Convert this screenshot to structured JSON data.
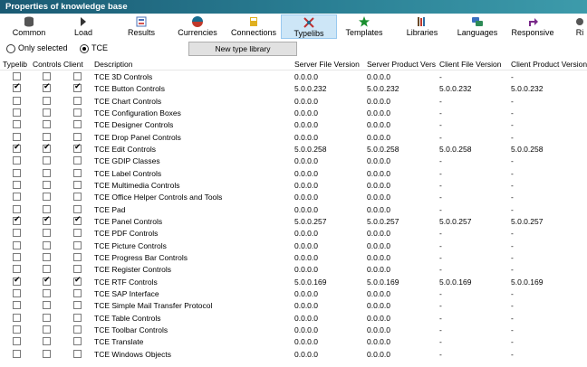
{
  "window": {
    "title": "Properties of knowledge base"
  },
  "toolbar": {
    "items": [
      {
        "label": "Common",
        "icon": "database-icon",
        "color": "#555555"
      },
      {
        "label": "Load",
        "icon": "load-icon",
        "color": "#333333"
      },
      {
        "label": "Results",
        "icon": "results-icon",
        "color": "#4a6fb5"
      },
      {
        "label": "Currencies",
        "icon": "currencies-icon",
        "color": "#1a6d8f"
      },
      {
        "label": "Connections",
        "icon": "connections-icon",
        "color": "#e0b020"
      },
      {
        "label": "Typelibs",
        "icon": "typelibs-icon",
        "color": "#c03030"
      },
      {
        "label": "Templates",
        "icon": "templates-icon",
        "color": "#1a8f2f"
      },
      {
        "label": "Libraries",
        "icon": "libraries-icon",
        "color": "#6b4a2a"
      },
      {
        "label": "Languages",
        "icon": "languages-icon",
        "color": "#3a6fc0"
      },
      {
        "label": "Responsive",
        "icon": "responsive-icon",
        "color": "#7a2a8a"
      },
      {
        "label": "Ri",
        "icon": "more-icon",
        "color": "#555555"
      }
    ],
    "active": "Typelibs"
  },
  "options": {
    "only_selected_label": "Only selected",
    "tce_label": "TCE",
    "selected": "TCE",
    "new_type_library_label": "New type library"
  },
  "table": {
    "columns": [
      "Typelib",
      "Controls",
      "Client",
      "Description",
      "Server File Version",
      "Server Product Versi...",
      "Client File Version",
      "Client Product Version"
    ],
    "rows": [
      {
        "typelib": false,
        "controls": false,
        "client": false,
        "description": "TCE 3D Controls",
        "server_file": "0.0.0.0",
        "server_product": "0.0.0.0",
        "client_file": "-",
        "client_product": "-"
      },
      {
        "typelib": true,
        "controls": true,
        "client": true,
        "description": "TCE Button Controls",
        "server_file": "5.0.0.232",
        "server_product": "5.0.0.232",
        "client_file": "5.0.0.232",
        "client_product": "5.0.0.232"
      },
      {
        "typelib": false,
        "controls": false,
        "client": false,
        "description": "TCE Chart Controls",
        "server_file": "0.0.0.0",
        "server_product": "0.0.0.0",
        "client_file": "-",
        "client_product": "-"
      },
      {
        "typelib": false,
        "controls": false,
        "client": false,
        "description": "TCE Configuration Boxes",
        "server_file": "0.0.0.0",
        "server_product": "0.0.0.0",
        "client_file": "-",
        "client_product": "-"
      },
      {
        "typelib": false,
        "controls": false,
        "client": false,
        "description": "TCE Designer Controls",
        "server_file": "0.0.0.0",
        "server_product": "0.0.0.0",
        "client_file": "-",
        "client_product": "-"
      },
      {
        "typelib": false,
        "controls": false,
        "client": false,
        "description": "TCE Drop Panel Controls",
        "server_file": "0.0.0.0",
        "server_product": "0.0.0.0",
        "client_file": "-",
        "client_product": "-"
      },
      {
        "typelib": true,
        "controls": true,
        "client": true,
        "description": "TCE Edit Controls",
        "server_file": "5.0.0.258",
        "server_product": "5.0.0.258",
        "client_file": "5.0.0.258",
        "client_product": "5.0.0.258"
      },
      {
        "typelib": false,
        "controls": false,
        "client": false,
        "description": "TCE GDIP Classes",
        "server_file": "0.0.0.0",
        "server_product": "0.0.0.0",
        "client_file": "-",
        "client_product": "-"
      },
      {
        "typelib": false,
        "controls": false,
        "client": false,
        "description": "TCE Label Controls",
        "server_file": "0.0.0.0",
        "server_product": "0.0.0.0",
        "client_file": "-",
        "client_product": "-"
      },
      {
        "typelib": false,
        "controls": false,
        "client": false,
        "description": "TCE Multimedia Controls",
        "server_file": "0.0.0.0",
        "server_product": "0.0.0.0",
        "client_file": "-",
        "client_product": "-"
      },
      {
        "typelib": false,
        "controls": false,
        "client": false,
        "description": "TCE Office Helper Controls and Tools",
        "server_file": "0.0.0.0",
        "server_product": "0.0.0.0",
        "client_file": "-",
        "client_product": "-"
      },
      {
        "typelib": false,
        "controls": false,
        "client": false,
        "description": "TCE Pad",
        "server_file": "0.0.0.0",
        "server_product": "0.0.0.0",
        "client_file": "-",
        "client_product": "-"
      },
      {
        "typelib": true,
        "controls": true,
        "client": true,
        "description": "TCE Panel Controls",
        "server_file": "5.0.0.257",
        "server_product": "5.0.0.257",
        "client_file": "5.0.0.257",
        "client_product": "5.0.0.257"
      },
      {
        "typelib": false,
        "controls": false,
        "client": false,
        "description": "TCE PDF Controls",
        "server_file": "0.0.0.0",
        "server_product": "0.0.0.0",
        "client_file": "-",
        "client_product": "-"
      },
      {
        "typelib": false,
        "controls": false,
        "client": false,
        "description": "TCE Picture Controls",
        "server_file": "0.0.0.0",
        "server_product": "0.0.0.0",
        "client_file": "-",
        "client_product": "-"
      },
      {
        "typelib": false,
        "controls": false,
        "client": false,
        "description": "TCE Progress Bar Controls",
        "server_file": "0.0.0.0",
        "server_product": "0.0.0.0",
        "client_file": "-",
        "client_product": "-"
      },
      {
        "typelib": false,
        "controls": false,
        "client": false,
        "description": "TCE Register Controls",
        "server_file": "0.0.0.0",
        "server_product": "0.0.0.0",
        "client_file": "-",
        "client_product": "-"
      },
      {
        "typelib": true,
        "controls": true,
        "client": true,
        "description": "TCE RTF Controls",
        "server_file": "5.0.0.169",
        "server_product": "5.0.0.169",
        "client_file": "5.0.0.169",
        "client_product": "5.0.0.169"
      },
      {
        "typelib": false,
        "controls": false,
        "client": false,
        "description": "TCE SAP Interface",
        "server_file": "0.0.0.0",
        "server_product": "0.0.0.0",
        "client_file": "-",
        "client_product": "-"
      },
      {
        "typelib": false,
        "controls": false,
        "client": false,
        "description": "TCE Simple Mail Transfer Protocol",
        "server_file": "0.0.0.0",
        "server_product": "0.0.0.0",
        "client_file": "-",
        "client_product": "-"
      },
      {
        "typelib": false,
        "controls": false,
        "client": false,
        "description": "TCE Table Controls",
        "server_file": "0.0.0.0",
        "server_product": "0.0.0.0",
        "client_file": "-",
        "client_product": "-"
      },
      {
        "typelib": false,
        "controls": false,
        "client": false,
        "description": "TCE Toolbar Controls",
        "server_file": "0.0.0.0",
        "server_product": "0.0.0.0",
        "client_file": "-",
        "client_product": "-"
      },
      {
        "typelib": false,
        "controls": false,
        "client": false,
        "description": "TCE Translate",
        "server_file": "0.0.0.0",
        "server_product": "0.0.0.0",
        "client_file": "-",
        "client_product": "-"
      },
      {
        "typelib": false,
        "controls": false,
        "client": false,
        "description": "TCE Windows Objects",
        "server_file": "0.0.0.0",
        "server_product": "0.0.0.0",
        "client_file": "-",
        "client_product": "-"
      }
    ]
  }
}
